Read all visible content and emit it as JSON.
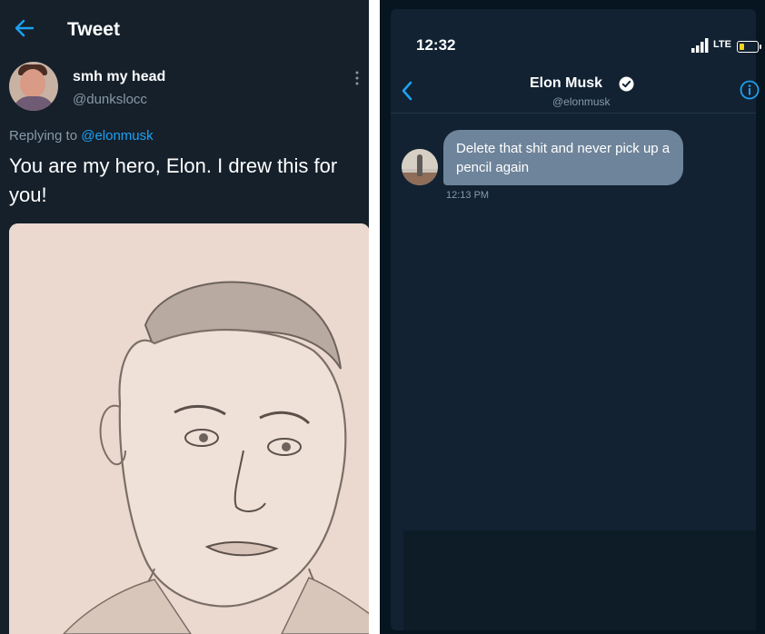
{
  "left": {
    "header": {
      "title": "Tweet",
      "back_icon": "back-arrow-icon"
    },
    "tweet": {
      "display_name": "smh my head",
      "handle": "@dunkslocc",
      "replying_label": "Replying to",
      "replying_mention": "@elonmusk",
      "text": "You are my hero, Elon. I drew this for you!",
      "media": "pencil-sketch-portrait"
    },
    "colors": {
      "background": "#15202b",
      "accent": "#1da1f2",
      "muted": "#8899a6"
    }
  },
  "right": {
    "status_bar": {
      "time": "12:32",
      "network": "LTE"
    },
    "dm_header": {
      "name": "Elon Musk",
      "handle": "@elonmusk",
      "verified_icon": "verified-badge-icon",
      "info_icon": "info-icon"
    },
    "message": {
      "text": "Delete that shit and never pick up a pencil again",
      "time": "12:13 PM"
    },
    "colors": {
      "background": "#122232",
      "bubble": "#6e849a"
    }
  }
}
